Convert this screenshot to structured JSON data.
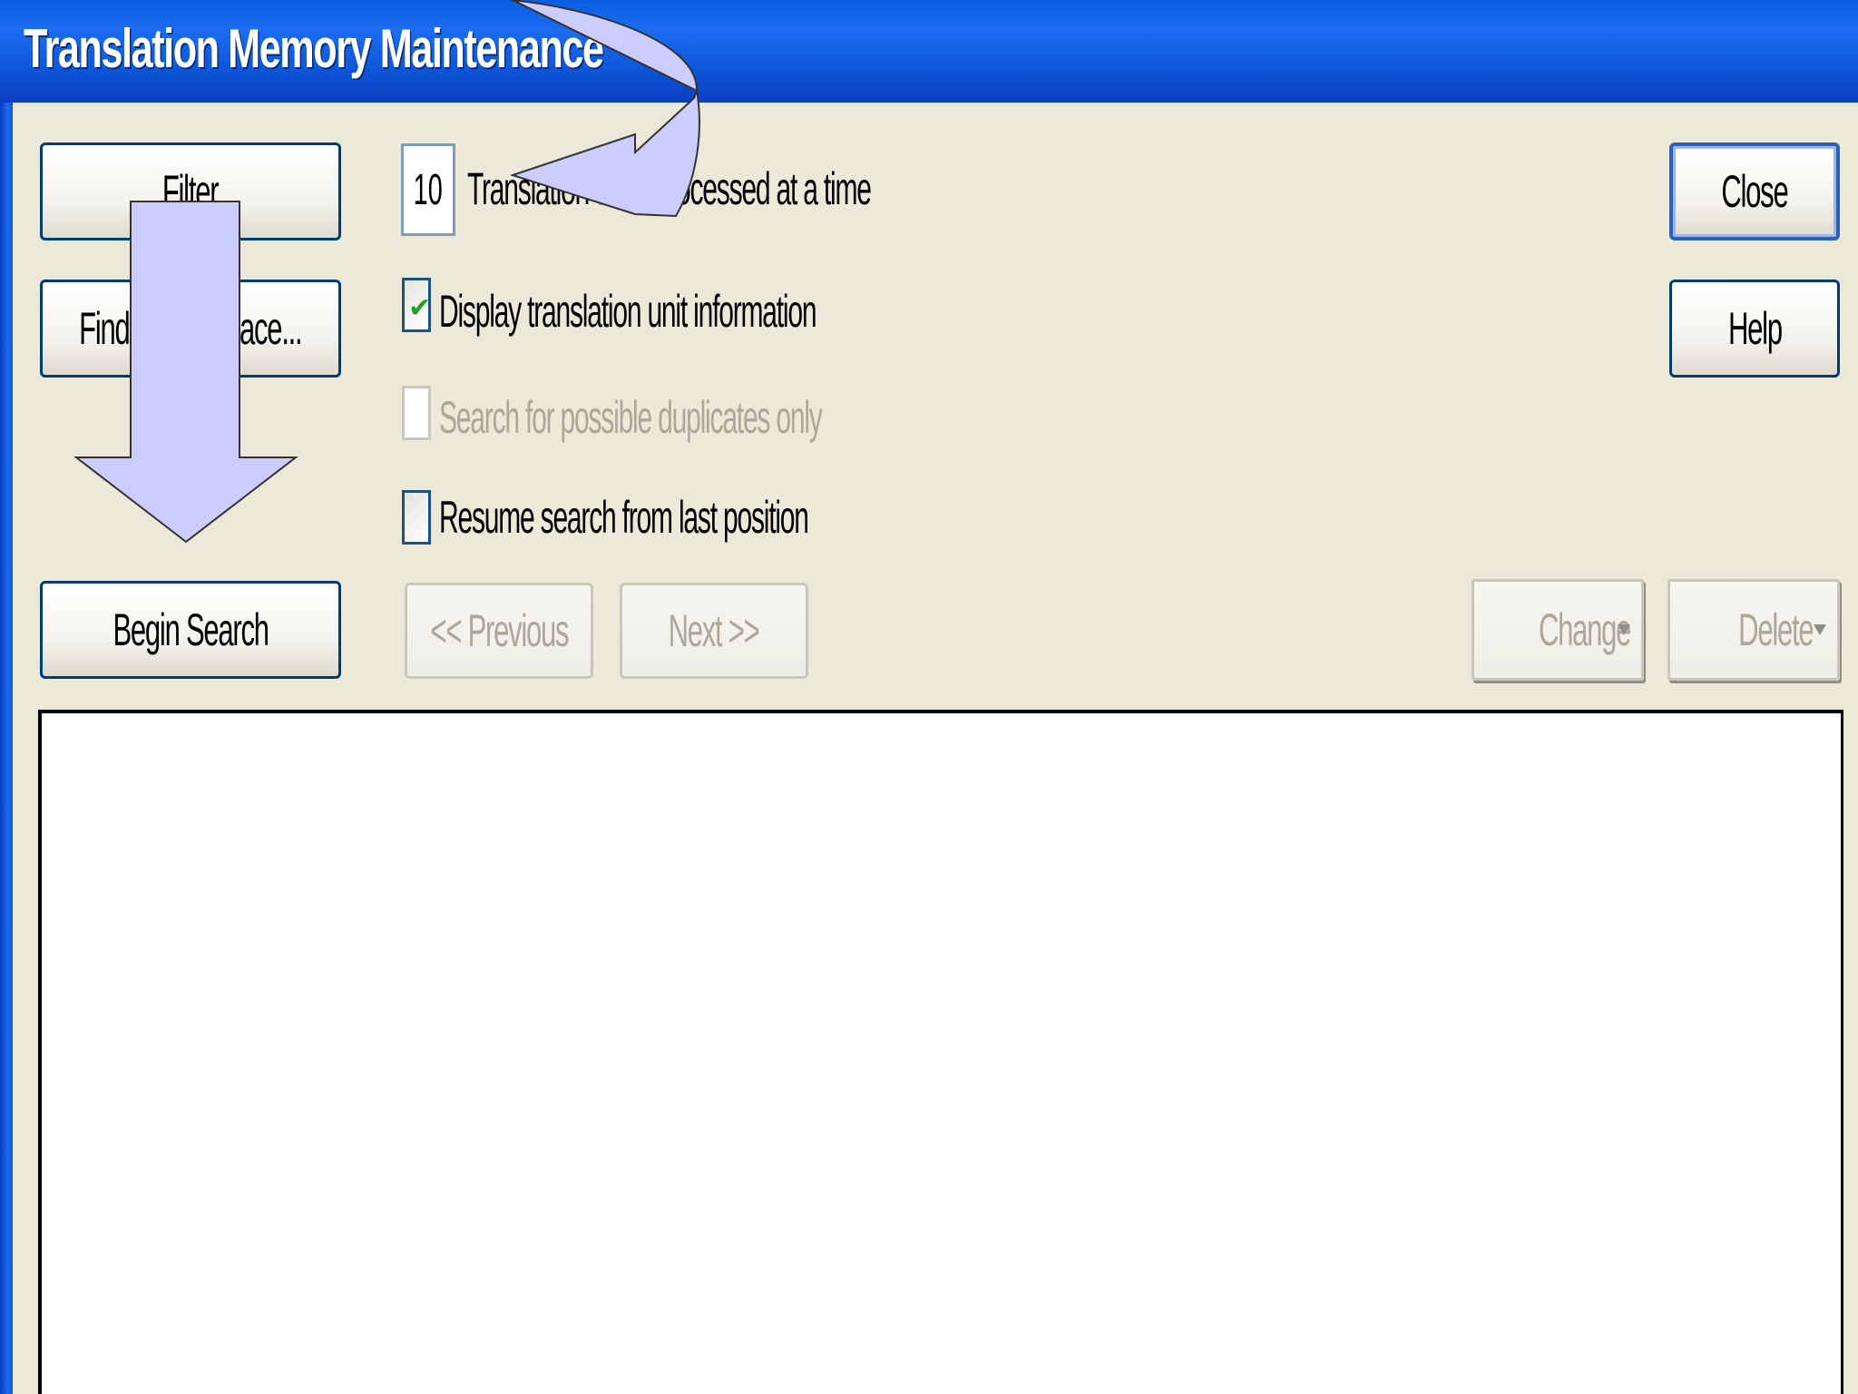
{
  "window": {
    "title": "Translation Memory Maintenance"
  },
  "buttons": {
    "filter": "Filter",
    "find_replace": "Find and Replace...",
    "begin_search": "Begin Search",
    "previous": "<< Previous",
    "next": "Next >>",
    "change": "Change",
    "delete": "Delete",
    "close": "Close",
    "help": "Help"
  },
  "options": {
    "tu_count_value": "10",
    "tu_count_label": "Translation units processed at a time",
    "display_tu_info": {
      "label": "Display translation unit information",
      "checked": true
    },
    "duplicates_only": {
      "label": "Search for possible duplicates only",
      "checked": false,
      "disabled": true
    },
    "resume_search": {
      "label": "Resume search from last position",
      "checked": false
    }
  },
  "colors": {
    "titlebar": "#0a5ee0",
    "window_bg": "#ece9d8",
    "annotation_arrow": "#ccccff",
    "checkmark": "#21a121"
  },
  "annotations": {
    "arrow_down_icon": "down-arrow-annotation",
    "curved_arrow_icon": "curved-arrow-annotation"
  }
}
